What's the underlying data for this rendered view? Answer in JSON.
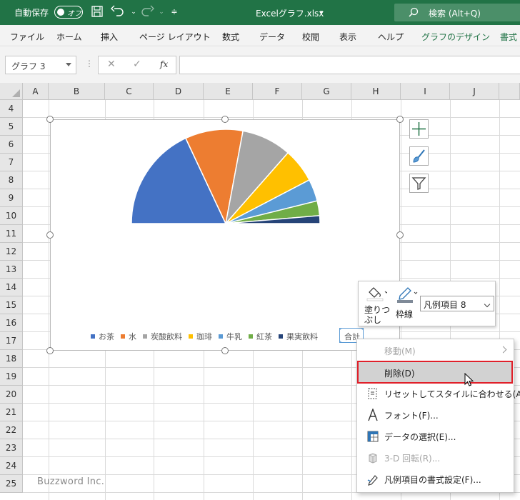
{
  "titlebar": {
    "autosave_label": "自動保存",
    "autosave_state": "オフ",
    "filename": "Excelグラフ.xlsx",
    "search_placeholder": "検索 (Alt+Q)"
  },
  "ribbon_tabs": [
    "ファイル",
    "ホーム",
    "挿入",
    "ページ レイアウト",
    "数式",
    "データ",
    "校閲",
    "表示",
    "ヘルプ",
    "グラフのデザイン",
    "書式"
  ],
  "formula_bar": {
    "name_box": "グラフ 3",
    "fx": "fx",
    "value": ""
  },
  "columns": [
    "A",
    "B",
    "C",
    "D",
    "E",
    "F",
    "G",
    "H",
    "I",
    "J"
  ],
  "rows": [
    "4",
    "5",
    "6",
    "7",
    "8",
    "9",
    "10",
    "11",
    "12",
    "13",
    "14",
    "15",
    "16",
    "17",
    "18",
    "19",
    "20",
    "21",
    "22",
    "23",
    "24",
    "25"
  ],
  "chart_data": {
    "type": "pie",
    "subtype": "half-pie",
    "categories": [
      "お茶",
      "水",
      "炭酸飲料",
      "珈琲",
      "牛乳",
      "紅茶",
      "果実飲料"
    ],
    "values": [
      20,
      11,
      9.5,
      6.5,
      4.2,
      2.8,
      1.5
    ],
    "hidden_total_category": "合計",
    "hidden_total_value": 55.5,
    "colors": [
      "#4472c4",
      "#ed7d31",
      "#a5a5a5",
      "#ffc000",
      "#5b9bd5",
      "#70ad47",
      "#264478"
    ],
    "title": "",
    "legend_position": "bottom",
    "selected_legend_entry": "合計"
  },
  "chart_buttons": [
    "plus-icon",
    "brush-icon",
    "filter-icon"
  ],
  "mini_toolbar": {
    "fill_label": "塗りつぶし",
    "outline_label": "枠線",
    "selector_value": "凡例項目 8"
  },
  "context_menu": [
    {
      "label": "移動(M)",
      "icon": "",
      "disabled": true,
      "submenu": true
    },
    {
      "label": "削除(D)",
      "icon": "",
      "disabled": false,
      "highlighted": true
    },
    {
      "label": "リセットしてスタイルに合わせる(A)",
      "icon": "reset-style-icon",
      "disabled": false
    },
    {
      "label": "フォント(F)...",
      "icon": "font-icon",
      "disabled": false
    },
    {
      "label": "データの選択(E)...",
      "icon": "select-data-icon",
      "disabled": false
    },
    {
      "label": "3-D 回転(R)...",
      "icon": "rotate-3d-icon",
      "disabled": true
    },
    {
      "label": "凡例項目の書式設定(F)...",
      "icon": "format-legend-icon",
      "disabled": false
    }
  ],
  "watermark": "Buzzword Inc."
}
